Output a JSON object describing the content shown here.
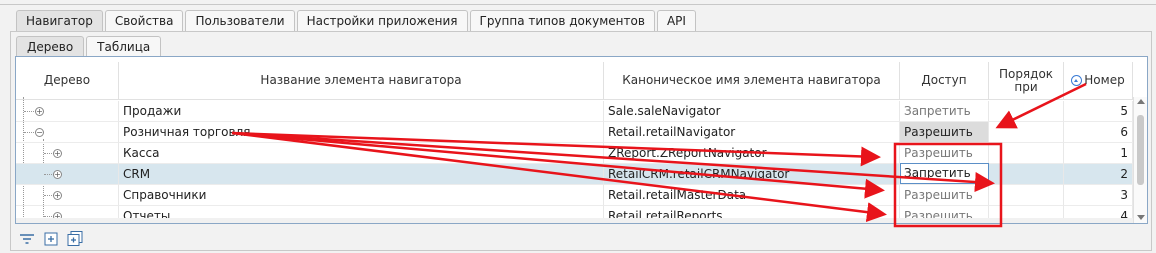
{
  "main_tabs": [
    "Навигатор",
    "Свойства",
    "Пользователи",
    "Настройки приложения",
    "Группа типов документов",
    "API"
  ],
  "sub_tabs": [
    "Дерево",
    "Таблица"
  ],
  "columns": {
    "tree": "Дерево",
    "name": "Название элемента навигатора",
    "canonical": "Каноническое имя элемента навигатора",
    "access": "Доступ",
    "order": "Порядок при",
    "number": "Номер"
  },
  "rows": [
    {
      "name": "Продажи",
      "canonical": "Sale.saleNavigator",
      "access": "Запретить",
      "number": "5"
    },
    {
      "name": "Розничная торговля",
      "canonical": "Retail.retailNavigator",
      "access": "Разрешить",
      "number": "6"
    },
    {
      "name": "Касса",
      "canonical": "ZReport.ZReportNavigator",
      "access": "Разрешить",
      "number": "1"
    },
    {
      "name": "CRM",
      "canonical": "RetailCRM.retailCRMNavigator",
      "access": "Запретить",
      "number": "2"
    },
    {
      "name": "Справочники",
      "canonical": "Retail.retailMasterData",
      "access": "Разрешить",
      "number": "3"
    },
    {
      "name": "Отчеты",
      "canonical": "Retail.retailReports",
      "access": "Разрешить",
      "number": "4"
    }
  ],
  "icons": {
    "filter": "filter-icon",
    "expand": "expand-all-icon",
    "expand_tree": "expand-tree-icon"
  },
  "colors": {
    "annotation": "#e8141b",
    "selection": "#d7e6ee",
    "grid_border": "#8aa7c6"
  }
}
